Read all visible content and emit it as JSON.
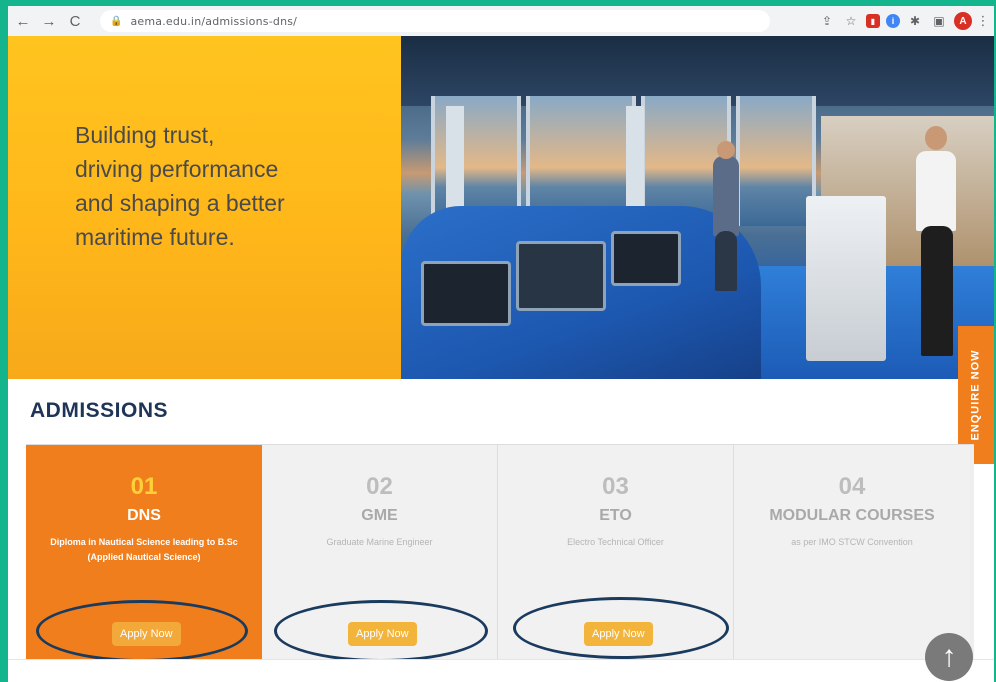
{
  "browser": {
    "url": "aema.edu.in/admissions-dns/",
    "back_icon": "←",
    "forward_icon": "→",
    "reload_icon": "C",
    "avatar_letter": "A"
  },
  "hero": {
    "tagline_line1": "Building trust,",
    "tagline_line2": "driving performance",
    "tagline_line3": "and shaping a better",
    "tagline_line4": "maritime future."
  },
  "enquire": {
    "label": "ENQUIRE NOW"
  },
  "admissions": {
    "title": "ADMISSIONS",
    "cards": [
      {
        "num": "01",
        "code": "DNS",
        "desc": "Diploma in Nautical Science leading to B.Sc (Applied Nautical Science)",
        "button": "Apply Now"
      },
      {
        "num": "02",
        "code": "GME",
        "desc": "Graduate Marine Engineer",
        "button": "Apply Now"
      },
      {
        "num": "03",
        "code": "ETO",
        "desc": "Electro Technical Officer",
        "button": "Apply Now"
      },
      {
        "num": "04",
        "code": "MODULAR COURSES",
        "desc": "as per IMO STCW Convention",
        "button": ""
      }
    ]
  },
  "colors": {
    "accent": "#f07e1c",
    "hero_yellow": "#ffb71a",
    "title_navy": "#1e3557",
    "frame_green": "#14b48c"
  }
}
